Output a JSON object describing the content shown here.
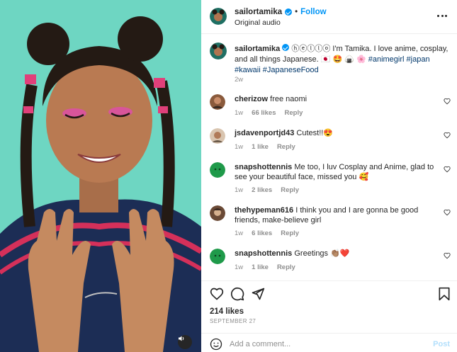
{
  "media": {
    "background_color": "#6ed6c2",
    "audio_icon": "speaker-icon"
  },
  "header": {
    "username": "sailortamika",
    "separator": "•",
    "follow_label": "Follow",
    "subtitle": "Original audio",
    "more_icon": "more-options-icon"
  },
  "caption": {
    "username": "sailortamika",
    "text_before_tags": "ⓗⓔⓛⓛⓞ I'm Tamika. I love anime, cosplay, and all things Japanese. 🇯🇵 🤩 🍙 🌸",
    "tags": [
      "#animegirl",
      "#japan",
      "#kawaii",
      "#JapaneseFood"
    ],
    "time": "2w"
  },
  "comments": [
    {
      "username": "cherizow",
      "text": "free naomi",
      "time": "1w",
      "likes": "66 likes",
      "reply": "Reply"
    },
    {
      "username": "jsdavenportjd43",
      "text": "Cutest!!😍",
      "time": "1w",
      "likes": "1 like",
      "reply": "Reply"
    },
    {
      "username": "snapshottennis",
      "text": "Me too, I luv Cosplay and Anime, glad to see your beautiful face, missed you 🥰",
      "time": "1w",
      "likes": "2 likes",
      "reply": "Reply"
    },
    {
      "username": "thehypeman616",
      "text": "I think you and I are gonna be good friends, make-believe girl",
      "time": "1w",
      "likes": "6 likes",
      "reply": "Reply"
    },
    {
      "username": "snapshottennis",
      "text": "Greetings 👏🏽❤️",
      "time": "1w",
      "likes": "1 like",
      "reply": "Reply"
    }
  ],
  "actions": {
    "likes_count": "214 likes",
    "date": "SEPTEMBER 27"
  },
  "add_comment": {
    "placeholder": "Add a comment...",
    "post_label": "Post"
  },
  "colors": {
    "link_blue": "#0095f6",
    "hashtag": "#00376b",
    "muted": "#8e8e8e",
    "post_disabled": "#b2dffc"
  }
}
